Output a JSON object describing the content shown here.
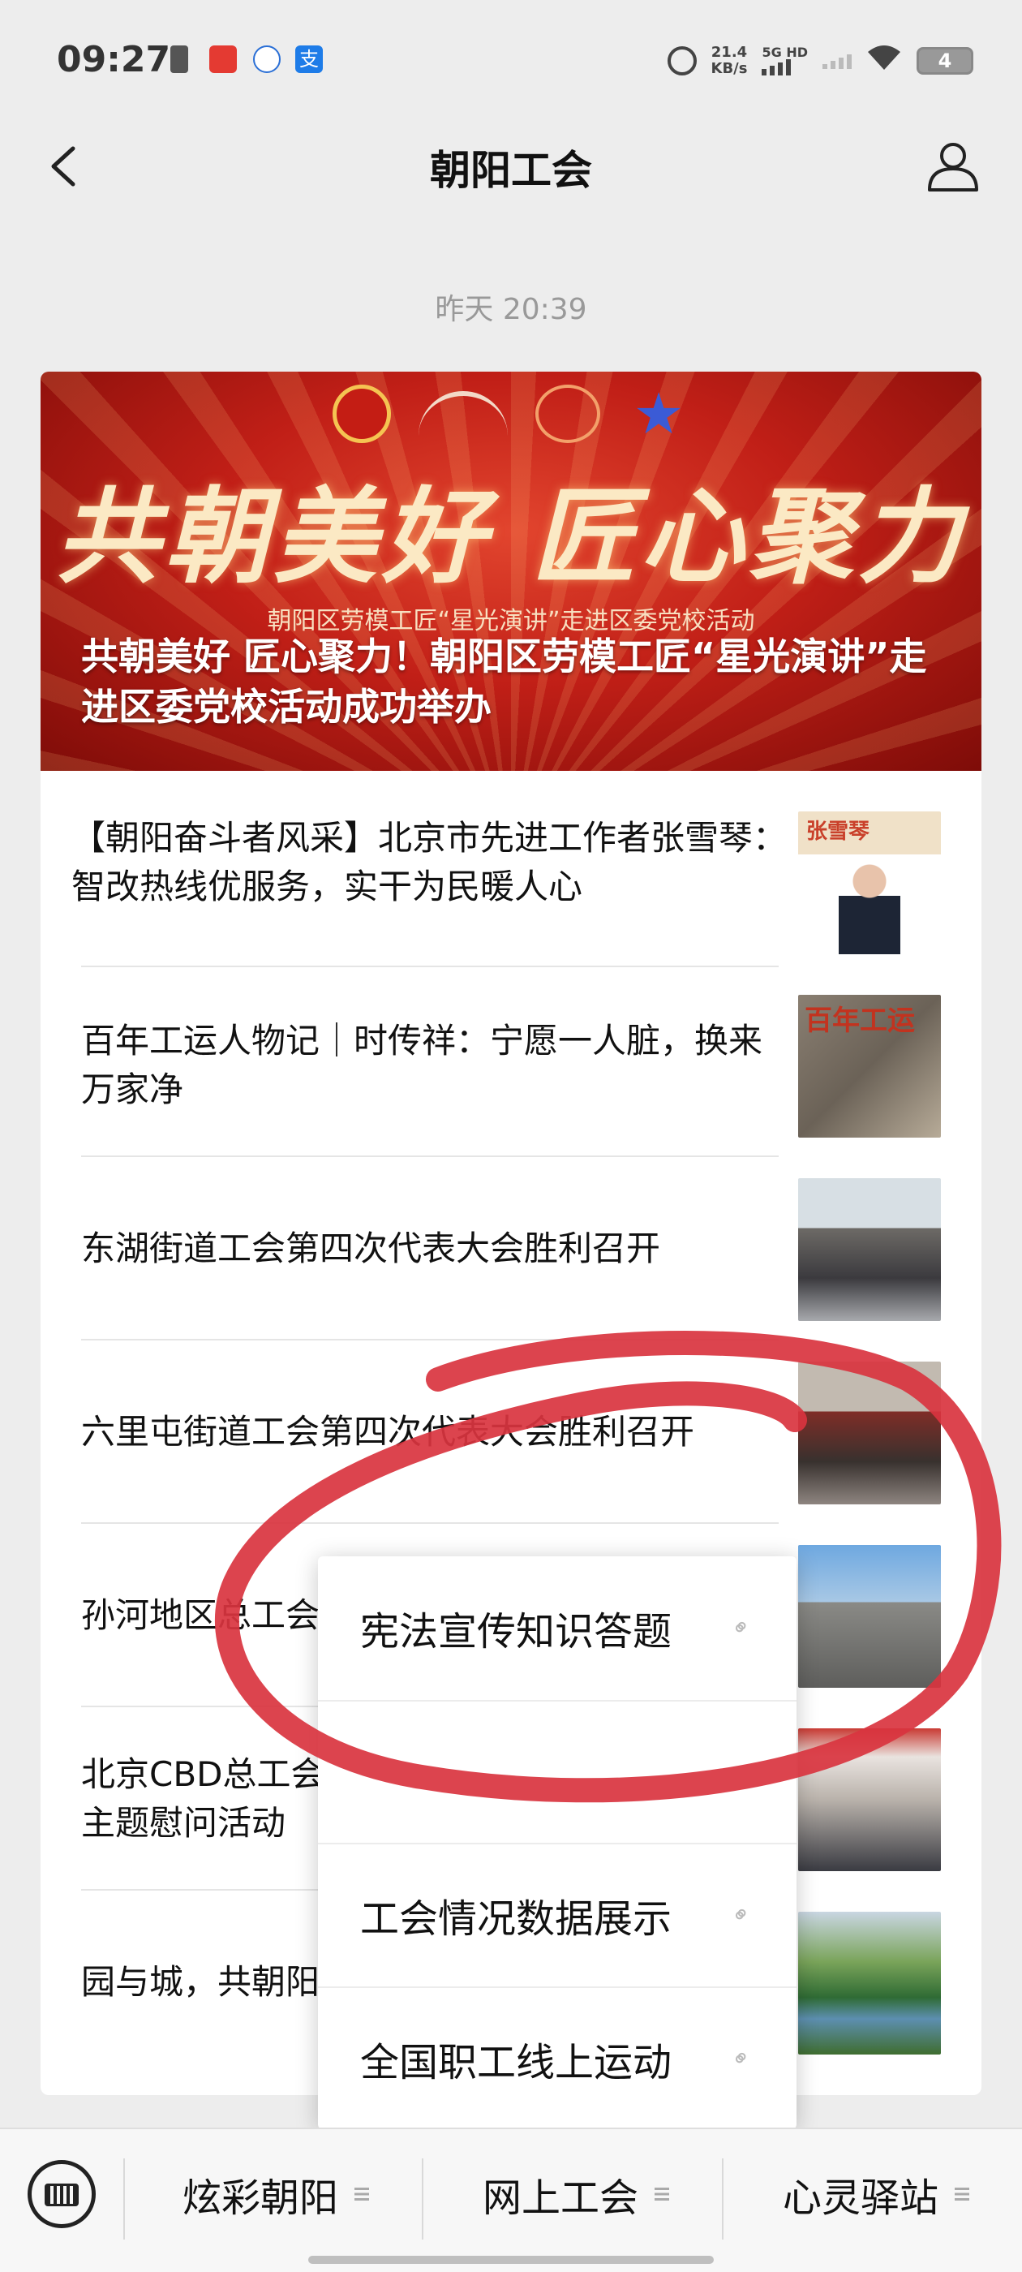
{
  "status_bar": {
    "time": "09:27",
    "app_icon_3_label": "支",
    "net_speed": "21.4",
    "net_speed_unit": "KB/s",
    "network_type": "5G HD",
    "battery_level": "4"
  },
  "nav": {
    "title": "朝阳工会"
  },
  "timestamp": "昨天 20:39",
  "featured": {
    "calligraphy": "共朝美好 匠心聚力",
    "subtitle": "朝阳区劳模工匠“星光演讲”走进区委党校活动",
    "title": "共朝美好 匠心聚力！朝阳区劳模工匠“星光演讲”走进区委党校活动成功举办"
  },
  "articles": [
    {
      "title": "【朝阳奋斗者风采】北京市先进工作者张雪琴：智改热线优服务，实干为民暖人心",
      "thumb_text": "张雪琴"
    },
    {
      "title": "百年工运人物记｜时传祥：宁愿一人脏，换来万家净",
      "thumb_text": "百年工运"
    },
    {
      "title": "东湖街道工会第四次代表大会胜利召开"
    },
    {
      "title": "六里屯街道工会第四次代表大会胜利召开"
    },
    {
      "title": "孙河地区总工会"
    },
    {
      "title": "北京CBD总工会\n主题慰问活动"
    },
    {
      "title": "园与城，共朝阳"
    }
  ],
  "popup_menu": {
    "items": [
      "宪法宣传知识答题",
      "",
      "工会情况数据展示",
      "全国职工线上运动"
    ]
  },
  "bottom_menu": {
    "tabs": [
      "炫彩朝阳",
      "网上工会",
      "心灵驿站"
    ]
  },
  "colors": {
    "annotation": "#d9343f",
    "banner_red": "#c11f17"
  }
}
